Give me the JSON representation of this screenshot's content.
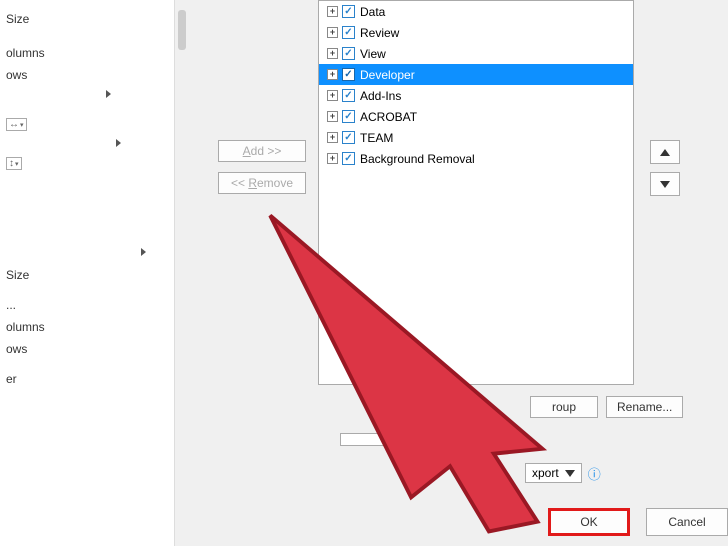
{
  "left_panel": {
    "items": [
      "",
      "",
      "Size",
      "",
      "olumns",
      "ows",
      "",
      "",
      "",
      "",
      "",
      "",
      "",
      "",
      "Size",
      "",
      "...",
      "olumns",
      "ows",
      "",
      "er",
      "",
      ""
    ]
  },
  "buttons": {
    "add": "Add >>",
    "remove": "<< Remove",
    "group": "roup",
    "rename": "Rename...",
    "ok": "OK",
    "cancel": "Cancel",
    "export": "xport"
  },
  "tree": {
    "items": [
      {
        "label": "Data",
        "checked": true,
        "selected": false
      },
      {
        "label": "Review",
        "checked": true,
        "selected": false
      },
      {
        "label": "View",
        "checked": true,
        "selected": false
      },
      {
        "label": "Developer",
        "checked": true,
        "selected": true
      },
      {
        "label": "Add-Ins",
        "checked": true,
        "selected": false
      },
      {
        "label": "ACROBAT",
        "checked": true,
        "selected": false
      },
      {
        "label": "TEAM",
        "checked": true,
        "selected": false
      },
      {
        "label": "Background Removal",
        "checked": true,
        "selected": false
      }
    ]
  }
}
